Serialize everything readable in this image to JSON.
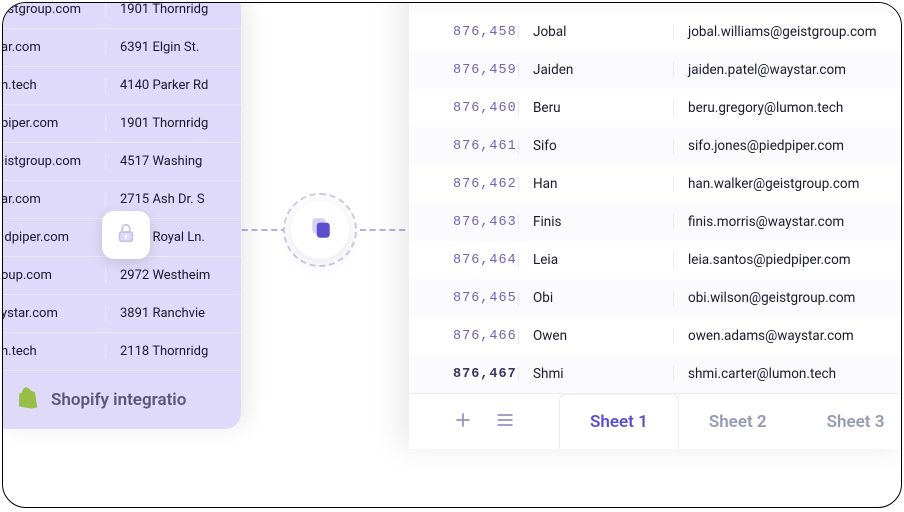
{
  "left_panel": {
    "rows": [
      {
        "domain": "·istgroup.com",
        "address": "1901 Thornridg"
      },
      {
        "domain": "ar.com",
        "address": "6391 Elgin St."
      },
      {
        "domain": "n.tech",
        "address": "4140 Parker Rd"
      },
      {
        "domain": "piper.com",
        "address": "1901 Thornridg"
      },
      {
        "domain": "·istgroup.com",
        "address": "4517 Washing"
      },
      {
        "domain": "ar.com",
        "address": "2715 Ash Dr. S"
      },
      {
        "domain": "·dpiper.com",
        "address": "2464 Royal Ln."
      },
      {
        "domain": "oup.com",
        "address": "2972 Westheim"
      },
      {
        "domain": "ystar.com",
        "address": "3891 Ranchvie"
      },
      {
        "domain": "n.tech",
        "address": "2118 Thornridg"
      }
    ],
    "shopify_label": "Shopify integratio"
  },
  "right_panel": {
    "rows": [
      {
        "id": "876,458",
        "name": "Jobal",
        "email": "jobal.williams@geistgroup.com"
      },
      {
        "id": "876,459",
        "name": "Jaiden",
        "email": "jaiden.patel@waystar.com"
      },
      {
        "id": "876,460",
        "name": "Beru",
        "email": "beru.gregory@lumon.tech"
      },
      {
        "id": "876,461",
        "name": "Sifo",
        "email": "sifo.jones@piedpiper.com"
      },
      {
        "id": "876,462",
        "name": "Han",
        "email": "han.walker@geistgroup.com"
      },
      {
        "id": "876,463",
        "name": "Finis",
        "email": "finis.morris@waystar.com"
      },
      {
        "id": "876,464",
        "name": "Leia",
        "email": "leia.santos@piedpiper.com"
      },
      {
        "id": "876,465",
        "name": "Obi",
        "email": "obi.wilson@geistgroup.com"
      },
      {
        "id": "876,466",
        "name": "Owen",
        "email": "owen.adams@waystar.com"
      },
      {
        "id": "876,467",
        "name": "Shmi",
        "email": "shmi.carter@lumon.tech",
        "bold": true
      }
    ],
    "tabs": [
      "Sheet 1",
      "Sheet 2",
      "Sheet 3"
    ],
    "active_tab": 0
  }
}
